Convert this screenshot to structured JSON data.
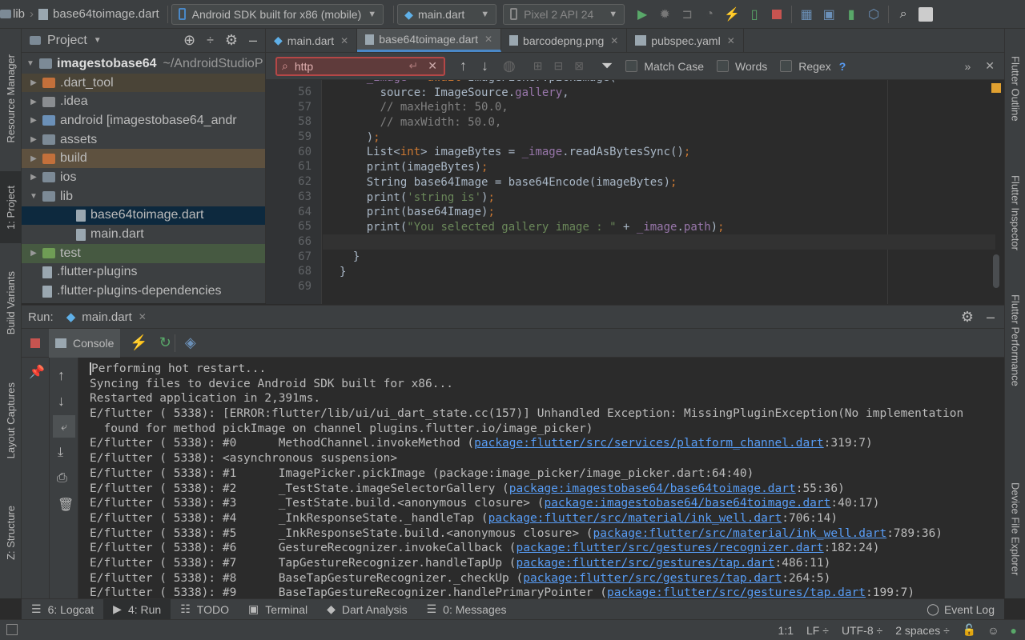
{
  "toolbar": {
    "crumb_folder": "lib",
    "crumb_file": "base64toimage.dart",
    "device_combo": "Android SDK built for x86 (mobile)",
    "run_config": "main.dart",
    "avd_combo": "Pixel 2 API 24"
  },
  "left_tabs": [
    "Resource Manager",
    "1: Project",
    "Build Variants",
    "Layout Captures",
    "Z: Structure"
  ],
  "right_tabs": [
    "Flutter Outline",
    "Flutter Inspector",
    "Flutter Performance",
    "Device File Explorer"
  ],
  "project": {
    "header": "Project",
    "root_name": "imagestobase64",
    "root_path": "~/AndroidStudioP",
    "items": [
      {
        "label": ".dart_tool",
        "kind": "folder-orange",
        "arrow": "▶"
      },
      {
        "label": ".idea",
        "kind": "folder-grey",
        "arrow": "▶"
      },
      {
        "label": "android [imagestobase64_andr",
        "kind": "folder-blue",
        "arrow": "▶"
      },
      {
        "label": "assets",
        "kind": "folder",
        "arrow": "▶"
      },
      {
        "label": "build",
        "kind": "folder-orange",
        "arrow": "▶"
      },
      {
        "label": "ios",
        "kind": "folder",
        "arrow": "▶"
      },
      {
        "label": "lib",
        "kind": "folder",
        "arrow": "▼"
      },
      {
        "label": "base64toimage.dart",
        "kind": "file",
        "arrow": ""
      },
      {
        "label": "main.dart",
        "kind": "file",
        "arrow": ""
      },
      {
        "label": "test",
        "kind": "folder-green",
        "arrow": "▶"
      },
      {
        "label": ".flutter-plugins",
        "kind": "file",
        "arrow": ""
      },
      {
        "label": ".flutter-plugins-dependencies",
        "kind": "file",
        "arrow": ""
      }
    ]
  },
  "editor_tabs": [
    "main.dart",
    "base64toimage.dart",
    "barcodepng.png",
    "pubspec.yaml"
  ],
  "find": {
    "query": "http",
    "match_case": "Match Case",
    "words": "Words",
    "regex": "Regex",
    "help": "?"
  },
  "code": {
    "line_numbers": [
      "56",
      "57",
      "58",
      "59",
      "60",
      "61",
      "62",
      "63",
      "64",
      "65",
      "66",
      "67",
      "68",
      "69"
    ]
  },
  "run": {
    "label": "Run:",
    "tab": "main.dart",
    "console_tab": "Console"
  },
  "console": {
    "l1": "Performing hot restart...",
    "l2": "Syncing files to device Android SDK built for x86...",
    "l3": "Restarted application in 2,391ms.",
    "l4": "E/flutter ( 5338): [ERROR:flutter/lib/ui/ui_dart_state.cc(157)] Unhandled Exception: MissingPluginException(No implementation",
    "l5": "  found for method pickImage on channel plugins.flutter.io/image_picker)",
    "l6a": "E/flutter ( 5338): #0      MethodChannel.invokeMethod (",
    "l6link": "package:flutter/src/services/platform_channel.dart",
    "l6b": ":319:7)",
    "l7": "E/flutter ( 5338): <asynchronous suspension>",
    "l8": "E/flutter ( 5338): #1      ImagePicker.pickImage (package:image_picker/image_picker.dart:64:40)",
    "l9a": "E/flutter ( 5338): #2      _TestState.imageSelectorGallery (",
    "l9link": "package:imagestobase64/base64toimage.dart",
    "l9b": ":55:36)",
    "l10a": "E/flutter ( 5338): #3      _TestState.build.<anonymous closure> (",
    "l10link": "package:imagestobase64/base64toimage.dart",
    "l10b": ":40:17)",
    "l11a": "E/flutter ( 5338): #4      _InkResponseState._handleTap (",
    "l11link": "package:flutter/src/material/ink_well.dart",
    "l11b": ":706:14)",
    "l12a": "E/flutter ( 5338): #5      _InkResponseState.build.<anonymous closure> (",
    "l12link": "package:flutter/src/material/ink_well.dart",
    "l12b": ":789:36)",
    "l13a": "E/flutter ( 5338): #6      GestureRecognizer.invokeCallback (",
    "l13link": "package:flutter/src/gestures/recognizer.dart",
    "l13b": ":182:24)",
    "l14a": "E/flutter ( 5338): #7      TapGestureRecognizer.handleTapUp (",
    "l14link": "package:flutter/src/gestures/tap.dart",
    "l14b": ":486:11)",
    "l15a": "E/flutter ( 5338): #8      BaseTapGestureRecognizer._checkUp (",
    "l15link": "package:flutter/src/gestures/tap.dart",
    "l15b": ":264:5)",
    "l16a": "E/flutter ( 5338): #9      BaseTapGestureRecognizer.handlePrimaryPointer (",
    "l16link": "package:flutter/src/gestures/tap.dart",
    "l16b": ":199:7)"
  },
  "bottom_tabs": {
    "logcat": "6: Logcat",
    "run": "4: Run",
    "todo": "TODO",
    "terminal": "Terminal",
    "dart": "Dart Analysis",
    "messages": "0: Messages",
    "eventlog": "Event Log"
  },
  "status": {
    "pos": "1:1",
    "lf": "LF ÷",
    "enc": "UTF-8 ÷",
    "indent": "2 spaces ÷"
  },
  "colors": {
    "accent": "#4a88c7",
    "error": "#b54747",
    "link": "#589df6"
  }
}
